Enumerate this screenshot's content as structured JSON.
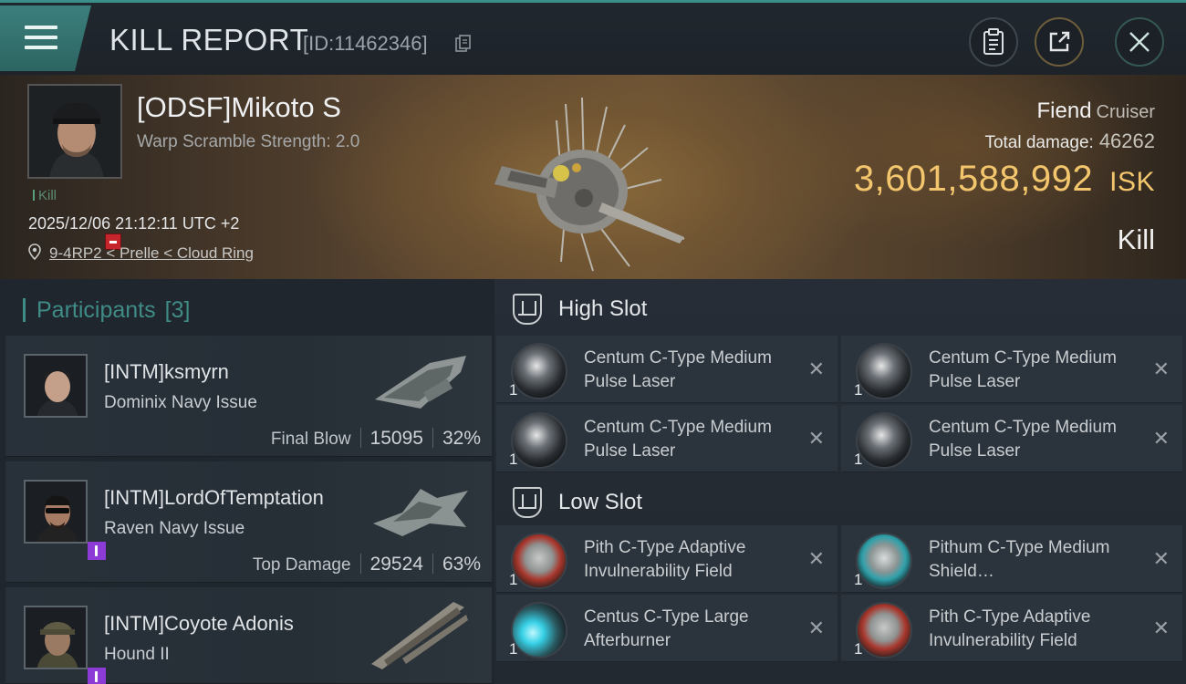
{
  "header": {
    "title": "KILL REPORT",
    "report_id": "[ID:11462346]"
  },
  "victim": {
    "name": "[ODSF]Mikoto S",
    "warp_scramble": "Warp Scramble Strength: 2.0",
    "tag": "Kill",
    "timestamp": "2025/12/06 21:12:11 UTC +2",
    "location": "9-4RP2 < Prelle < Cloud Ring",
    "ship_name": "Fiend",
    "ship_class": "Cruiser",
    "total_damage_label": "Total damage:",
    "total_damage": "46262",
    "isk_value": "3,601,588,992",
    "isk_unit": "ISK",
    "result": "Kill"
  },
  "participants": {
    "title": "Participants",
    "count": "[3]",
    "list": [
      {
        "name": "[INTM]ksmyrn",
        "ship": "Dominix Navy Issue",
        "stat_label": "Final Blow",
        "damage": "15095",
        "percent": "32%"
      },
      {
        "name": "[INTM]LordOfTemptation",
        "ship": "Raven Navy Issue",
        "stat_label": "Top Damage",
        "damage": "29524",
        "percent": "63%"
      },
      {
        "name": "[INTM]Coyote Adonis",
        "ship": "Hound II",
        "stat_label": "",
        "damage": "",
        "percent": ""
      }
    ]
  },
  "fitting": {
    "high_slot_label": "High Slot",
    "low_slot_label": "Low Slot",
    "high_slot": [
      {
        "name": "Centum C-Type Medium Pulse Laser",
        "qty": "1",
        "icon": "laser-icon"
      },
      {
        "name": "Centum C-Type Medium Pulse Laser",
        "qty": "1",
        "icon": "laser-icon"
      },
      {
        "name": "Centum C-Type Medium Pulse Laser",
        "qty": "1",
        "icon": "laser-icon"
      },
      {
        "name": "Centum C-Type Medium Pulse Laser",
        "qty": "1",
        "icon": "laser-icon"
      }
    ],
    "low_slot": [
      {
        "name": "Pith C-Type Adaptive Invulnerability Field",
        "qty": "1",
        "icon": "shield-module-icon"
      },
      {
        "name": "Pithum C-Type Medium Shield…",
        "qty": "1",
        "icon": "shield-booster-icon"
      },
      {
        "name": "Centus C-Type Large Afterburner",
        "qty": "1",
        "icon": "afterburner-icon"
      },
      {
        "name": "Pith C-Type Adaptive Invulnerability Field",
        "qty": "1",
        "icon": "shield-module-icon"
      }
    ],
    "close_glyph": "✕"
  }
}
